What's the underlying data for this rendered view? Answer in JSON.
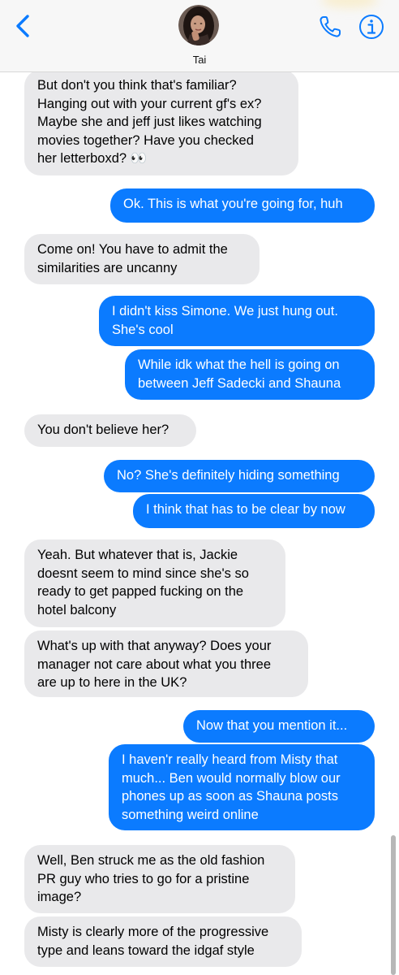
{
  "contact": {
    "name": "Tai"
  },
  "colors": {
    "incoming": "#e9e9eb",
    "outgoing": "#0b7bff",
    "accent": "#0b7bff"
  },
  "icons": {
    "back": "chevron-left-icon",
    "call": "phone-icon",
    "info": "info-icon"
  },
  "messages": [
    {
      "from": "them",
      "text": "But don't you think that's familiar?\nHanging out with your current gf's ex?\nMaybe she and jeff just likes watching\nmovies together? Have you checked\nher letterboxd? 👀"
    },
    {
      "from": "me",
      "text": "Ok. This is what you're going for, huh"
    },
    {
      "from": "them",
      "text": "Come on! You have to admit the\nsimilarities are uncanny"
    },
    {
      "from": "me",
      "text": "I didn't kiss Simone. We just hung out.\nShe's cool"
    },
    {
      "from": "me",
      "text": "While idk what the hell is going on\nbetween Jeff Sadecki and Shauna"
    },
    {
      "from": "them",
      "text": "You don't believe her?"
    },
    {
      "from": "me",
      "text": "No? She's definitely hiding something"
    },
    {
      "from": "me",
      "text": "I think that has to be clear by now"
    },
    {
      "from": "them",
      "text": "Yeah. But whatever that is, Jackie\ndoesnt seem to mind since she's so\nready to get papped fucking on the\nhotel balcony"
    },
    {
      "from": "them",
      "text": "What's up with that anyway? Does your\nmanager not care about what you three\nare up to here in the UK?"
    },
    {
      "from": "me",
      "text": "Now that you mention it..."
    },
    {
      "from": "me",
      "text": "I haven'r really heard from Misty that\nmuch... Ben would normally blow our\nphones up as soon as Shauna posts\nsomething weird online"
    },
    {
      "from": "them",
      "text": "Well, Ben struck me as the old fashion\nPR guy who tries to go for a pristine\nimage?"
    },
    {
      "from": "them",
      "text": "Misty is clearly more of the progressive\ntype and leans toward the idgaf style"
    }
  ]
}
